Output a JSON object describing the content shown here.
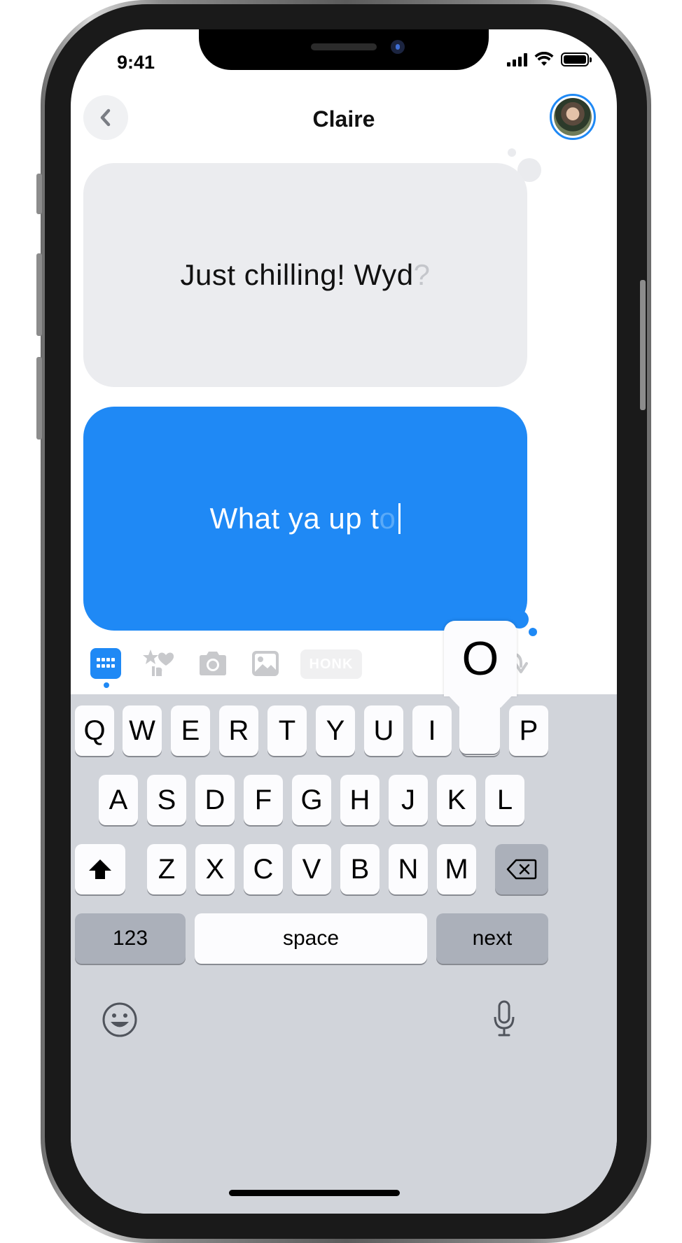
{
  "status_bar": {
    "time": "9:41"
  },
  "header": {
    "title": "Claire"
  },
  "messages": {
    "received": {
      "text": "Just chilling! Wyd",
      "ghost_char": "?"
    },
    "sent": {
      "text": "What ya up t",
      "ghost_char": "o"
    }
  },
  "toolbar": {
    "honk_label": "HONK"
  },
  "keyboard": {
    "row1": [
      "Q",
      "W",
      "E",
      "R",
      "T",
      "Y",
      "U",
      "I",
      "O",
      "P"
    ],
    "row2": [
      "A",
      "S",
      "D",
      "F",
      "G",
      "H",
      "J",
      "K",
      "L"
    ],
    "row3": [
      "Z",
      "X",
      "C",
      "V",
      "B",
      "N",
      "M"
    ],
    "numbers_label": "123",
    "space_label": "space",
    "next_label": "next",
    "popup_char": "O"
  },
  "colors": {
    "accent": "#1f89f5",
    "received_bubble": "#ebecef",
    "keyboard_bg": "#d1d4da"
  }
}
